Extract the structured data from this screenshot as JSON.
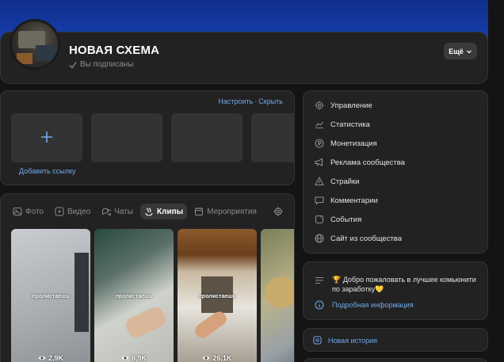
{
  "header": {
    "group_name": "НОВАЯ СХЕМА",
    "subscription_status": "Вы подписаны",
    "more_label": "Ещё",
    "cover_color": "#1741b5"
  },
  "links": {
    "configure_label": "Настроить",
    "separator": "·",
    "hide_label": "Скрыть",
    "add_link_label": "Добавить ссылку"
  },
  "media_tabs": [
    {
      "label": "Фото",
      "icon": "photo-icon",
      "active": false
    },
    {
      "label": "Видео",
      "icon": "video-icon",
      "active": false
    },
    {
      "label": "Чаты",
      "icon": "chats-icon",
      "active": false
    },
    {
      "label": "Клипы",
      "icon": "clips-icon",
      "active": true
    },
    {
      "label": "Мероприятия",
      "icon": "calendar-icon",
      "active": false
    }
  ],
  "clips": [
    {
      "caption": "пролистаешь",
      "views": "2,9K"
    },
    {
      "caption": "пролистаешь",
      "views": "6,9K"
    },
    {
      "caption": "пролистаешь",
      "views": "26,1K"
    },
    {
      "caption": "",
      "views": ""
    }
  ],
  "manage_menu": [
    {
      "label": "Управление",
      "icon": "gear-icon"
    },
    {
      "label": "Статистика",
      "icon": "stats-icon"
    },
    {
      "label": "Монетизация",
      "icon": "coin-icon"
    },
    {
      "label": "Реклама сообщества",
      "icon": "megaphone-icon"
    },
    {
      "label": "Страйки",
      "icon": "warning-icon"
    },
    {
      "label": "Комментарии",
      "icon": "comment-icon"
    },
    {
      "label": "События",
      "icon": "events-icon"
    },
    {
      "label": "Сайт из сообщества",
      "icon": "globe-icon"
    }
  ],
  "welcome": {
    "text": "🏆 Добро пожаловать в лучшее комьюнити по заработку💛",
    "info_link": "Подробная информация"
  },
  "story": {
    "new_story_label": "Новая история"
  }
}
